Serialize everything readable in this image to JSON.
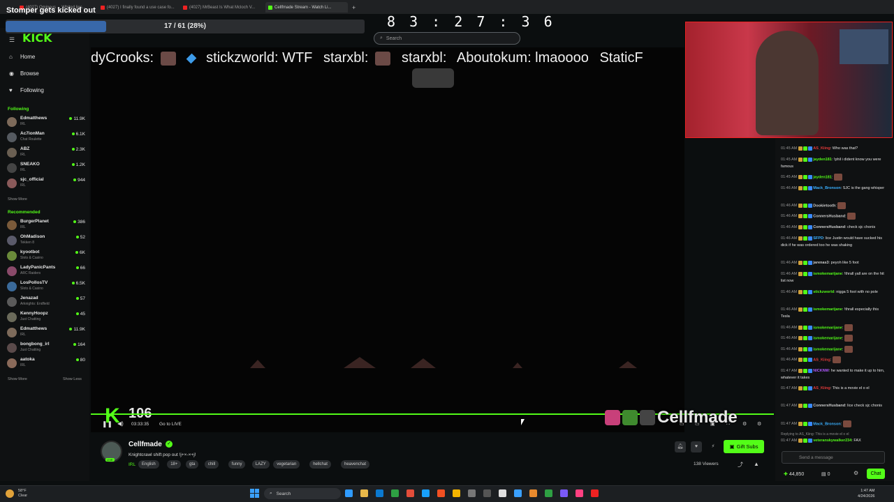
{
  "browser": {
    "tabs": [
      {
        "label": "(4027) Ominous ... Whited lies...",
        "color": "#e22"
      },
      {
        "label": "(4027) I finally found a use case fo...",
        "color": "#e22"
      },
      {
        "label": "(4027) MrBeast Is What Mcloch V...",
        "color": "#e22"
      },
      {
        "label": "Cellfmade Stream - Watch Li...",
        "color": "#53fc18"
      }
    ]
  },
  "overlay": {
    "title": "Stomper gets kicked out",
    "progress_text": "17 / 61 (28%)",
    "progress_fraction": 0.28,
    "timer": "8 3 : 2 7 : 3 6"
  },
  "header": {
    "search_placeholder": "Search"
  },
  "sidebar": {
    "logo": "KICK",
    "nav": [
      {
        "label": "Home",
        "icon": "home-icon"
      },
      {
        "label": "Browse",
        "icon": "browse-icon"
      },
      {
        "label": "Following",
        "icon": "heart-icon"
      }
    ],
    "following_header": "Following",
    "following": [
      {
        "name": "Edmatthews",
        "category": "IRL",
        "viewers": "11.9K",
        "color": "#7d6a5a"
      },
      {
        "name": "Ac7ionMan",
        "category": "Chat Roulette",
        "viewers": "6.1K",
        "color": "#555a60"
      },
      {
        "name": "ABZ",
        "category": "IRL",
        "viewers": "2.3K",
        "color": "#6a5f52"
      },
      {
        "name": "SNEAKO",
        "category": "IRL",
        "viewers": "1.2K",
        "color": "#444"
      },
      {
        "name": "sjc_official",
        "category": "IRL",
        "viewers": "944",
        "color": "#8a5a5a"
      }
    ],
    "show_more_1": "Show More",
    "recommended_header": "Recommended",
    "recommended": [
      {
        "name": "BurgerPlanet",
        "category": "IRL",
        "viewers": "386",
        "color": "#7a5a3a"
      },
      {
        "name": "OhMadison",
        "category": "Tekken 8",
        "viewers": "52",
        "color": "#5a5a6a"
      },
      {
        "name": "kyootbot",
        "category": "Slots & Casino",
        "viewers": "6K",
        "color": "#6a8a3a"
      },
      {
        "name": "LadyPanicPants",
        "category": "ARC Raiders",
        "viewers": "66",
        "color": "#8a4a6a"
      },
      {
        "name": "LosPollosTV",
        "category": "Slots & Casino",
        "viewers": "6.5K",
        "color": "#3a6a9a"
      },
      {
        "name": "Jenazad",
        "category": "Arknights: Endfield",
        "viewers": "57",
        "color": "#5a5a5a"
      },
      {
        "name": "KennyHoopz",
        "category": "Just Chatting",
        "viewers": "45",
        "color": "#6a6a5a"
      },
      {
        "name": "Edmatthews",
        "category": "IRL",
        "viewers": "11.9K",
        "color": "#7d6a5a"
      },
      {
        "name": "bongbong_irl",
        "category": "Just Chatting",
        "viewers": "164",
        "color": "#5a4a4a"
      },
      {
        "name": "aatoka",
        "category": "IRL",
        "viewers": "80",
        "color": "#8a6a5a"
      }
    ],
    "show_more_2": "Show More",
    "show_less": "Show Less"
  },
  "video": {
    "ticker": [
      "dyCrooks:",
      "stickzworld: WTF",
      "starxbl:",
      "starxbl:",
      "Aboutokum: lmaoooo",
      "StaticF"
    ],
    "viewer_overlay": "106",
    "time": "03:33:35",
    "go_live": "Go to LIVE",
    "watermark": "Cellfmade"
  },
  "stream": {
    "name": "Cellfmade",
    "title": "Knightcrawl shift pop out  !j+×-×+j!",
    "category": "IRL",
    "tags": [
      "English",
      "18+",
      "gta",
      "chill",
      "funny",
      "LAZY",
      "vegetarian",
      "hellchat",
      "heavenchat"
    ],
    "gift_subs": "Gift Subs",
    "viewers": "138 Viewers",
    "live_badge": "LIVE"
  },
  "chat": {
    "messages": [
      {
        "ts": "01:45 AM",
        "user": "AS_Kiing",
        "color": "#e23a3a",
        "text": "Who was that?"
      },
      {
        "ts": "01:45 AM",
        "user": "jayden181",
        "color": "#53fc18",
        "text": "!phil i dident know you were famous"
      },
      {
        "ts": "01:45 AM",
        "user": "jayden181",
        "color": "#53fc18",
        "text": ""
      },
      {
        "ts": "01:46 AM",
        "user": "Mack_Bronson",
        "color": "#3ab0ff",
        "text": "SJC is the gang whisper"
      },
      {
        "ts": "01:46 AM",
        "user": "Dookietooth",
        "color": "#cccccc",
        "text": ""
      },
      {
        "ts": "01:46 AM",
        "user": "ConnersHusband",
        "color": "#cccccc",
        "text": ""
      },
      {
        "ts": "01:46 AM",
        "user": "ConnersHusband",
        "color": "#cccccc",
        "text": "check sjc chonis"
      },
      {
        "ts": "01:46 AM",
        "user": "SFPD",
        "color": "#3ab0ff",
        "text": "lice Justin would have sucked his dick if he was ordered too he was shaking"
      },
      {
        "ts": "01:46 AM",
        "user": "jarenas3",
        "color": "#cccccc",
        "text": "peyoh like 5 foot"
      },
      {
        "ts": "01:46 AM",
        "user": "ismokemarijane",
        "color": "#53fc18",
        "text": "!thrall yall are on the hit list now"
      },
      {
        "ts": "01:46 AM",
        "user": "stickzworld",
        "color": "#53fc18",
        "text": "nigga 5 foot with no pole"
      },
      {
        "ts": "01:46 AM",
        "user": "ismokemarijane",
        "color": "#53fc18",
        "text": "!thrall especially this Tesla"
      },
      {
        "ts": "01:46 AM",
        "user": "ismokemarijane",
        "color": "#53fc18",
        "text": ""
      },
      {
        "ts": "01:46 AM",
        "user": "ismokemarijane",
        "color": "#53fc18",
        "text": ""
      },
      {
        "ts": "01:46 AM",
        "user": "ismokemarijane",
        "color": "#53fc18",
        "text": ""
      },
      {
        "ts": "01:46 AM",
        "user": "AS_Kiing",
        "color": "#e23a3a",
        "text": ""
      },
      {
        "ts": "01:47 AM",
        "user": "NICKNW",
        "color": "#b05aff",
        "text": "he wanted to make it up to him, whatever it takes"
      },
      {
        "ts": "01:47 AM",
        "user": "AS_Kiing",
        "color": "#e23a3a",
        "text": "This is a movie el o el"
      },
      {
        "ts": "01:47 AM",
        "user": "ConnersHusband",
        "color": "#cccccc",
        "text": "lice check sjc chonis"
      },
      {
        "ts": "01:47 AM",
        "user": "Mack_Bronson",
        "color": "#3ab0ff",
        "text": ""
      },
      {
        "ts": "01:47 AM",
        "user": "veteranskywalker234",
        "color": "#53fc18",
        "text": "FAX"
      }
    ],
    "reply_hint": "Replying to AS_Kiing: This is a movie el o el",
    "input_placeholder": "Send a message",
    "points": "44,850",
    "points2": "0",
    "chat_button": "Chat"
  },
  "taskbar": {
    "weather_temp": "58°F",
    "weather_desc": "Clear",
    "search_label": "Search",
    "time": "1:47 AM",
    "date": "4/24/2026"
  }
}
